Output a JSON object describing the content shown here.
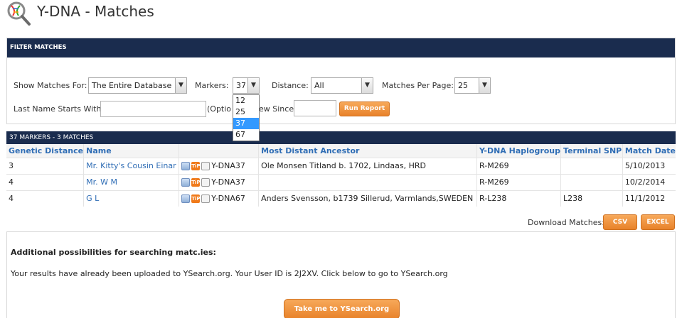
{
  "page": {
    "title": "Y-DNA - Matches"
  },
  "filter": {
    "header": "FILTER MATCHES",
    "show_matches_label": "Show Matches For:",
    "show_matches_value": "The Entire Database",
    "markers_label": "Markers:",
    "markers_value": "37",
    "markers_options": [
      "12",
      "25",
      "37",
      "67"
    ],
    "distance_label": "Distance:",
    "distance_value": "All",
    "per_page_label": "Matches Per Page:",
    "per_page_value": "25",
    "last_name_label": "Last Name Starts With:",
    "optional_label": "(Optio",
    "view_since_label": "ew Since:",
    "run_report": "Run Report"
  },
  "results": {
    "header": "37 MARKERS - 3 MATCHES",
    "columns": [
      "Genetic Distance",
      "Name",
      "",
      "Most Distant Ancestor",
      "Y-DNA Haplogroup",
      "Terminal SNP",
      "Match Date"
    ],
    "rows": [
      {
        "distance": "3",
        "name": "Mr. Kitty's Cousin Einar",
        "test": "Y-DNA37",
        "ancestor": "Ole Monsen Titland b. 1702, Lindaas, HRD",
        "haplogroup": "R-M269",
        "snp": "",
        "date": "5/10/2013"
      },
      {
        "distance": "4",
        "name": "Mr. W M",
        "test": "Y-DNA37",
        "ancestor": "",
        "haplogroup": "R-M269",
        "snp": "",
        "date": "10/2/2014"
      },
      {
        "distance": "4",
        "name": "G          L",
        "test": "Y-DNA67",
        "ancestor": "Anders Svensson, b1739 Sillerud, Varmlands,SWEDEN",
        "haplogroup": "R-L238",
        "snp": "L238",
        "date": "11/1/2012"
      }
    ],
    "tip_icon_text": "TiP"
  },
  "download": {
    "label": "Download Matches:",
    "csv": "CSV",
    "excel": "EXCEL"
  },
  "extra": {
    "heading": "Additional possibilities for searching matc.ies:",
    "body": "Your results have already been uploaded to YSearch.org. Your User ID is 2J2XV. Click below to go to YSearch.org",
    "button": "Take me to YSearch.org"
  },
  "colors": {
    "header_bg": "#1a2c4e",
    "link": "#2f6db5",
    "button": "#e8822a",
    "selected_option": "#3399ff"
  }
}
